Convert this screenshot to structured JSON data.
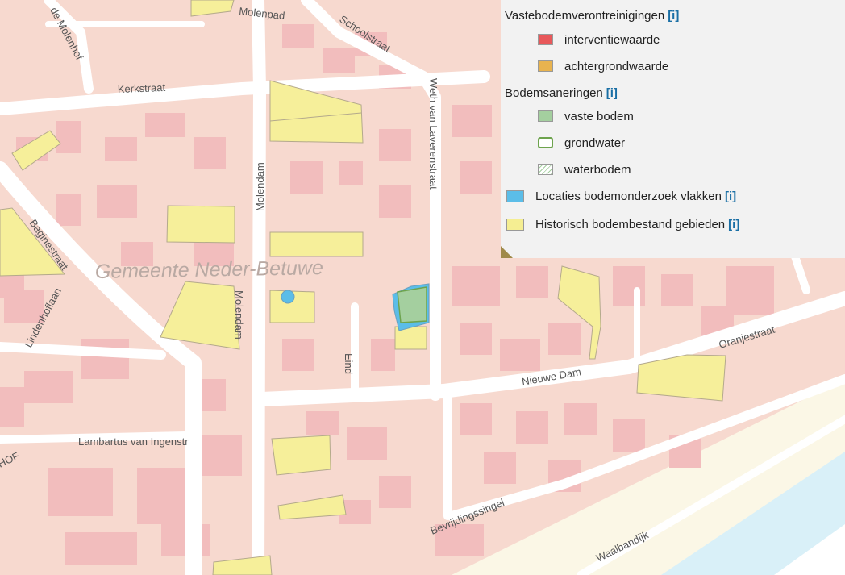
{
  "map": {
    "municipality_label": "Gemeente Neder-Betuwe",
    "streets": {
      "molenhof": "de Molenhof",
      "molenpad": "Molenpad",
      "schoolstraat": "Schoolstraat",
      "kerkstraat": "Kerkstraat",
      "molendam_north": "Molendam",
      "molendam_south": "Molendam",
      "laverenstraat": "Weth van Laverenstraat",
      "baginestraat": "Baginestraat",
      "lindenhoflaan": "Lindenhoflaan",
      "eind": "Eind",
      "nieuwe_dam": "Nieuwe Dam",
      "oranjestraat": "Oranjestraat",
      "lambartus": "Lambartus van Ingenstr",
      "hof": "HOF",
      "bevrijdingssingel": "Bevrijdingssingel",
      "waalbandijk": "Waalbandijk"
    },
    "colors": {
      "base": "#f7d9cf",
      "road": "#ffffff",
      "building": "#f2bdbd",
      "historic": "#f6ef9a",
      "historic_stroke": "#b4a98c",
      "dike_band": "#fbf7e6",
      "river": "#cfe9f5"
    }
  },
  "legend": {
    "section1_title": "Vastebodemverontreinigingen",
    "interventiewaarde": "interventiewaarde",
    "achtergrondwaarde": "achtergrondwaarde",
    "section2_title": "Bodemsaneringen",
    "vaste_bodem": "vaste bodem",
    "grondwater": "grondwater",
    "waterbodem": "waterbodem",
    "locaties": "Locaties bodemonderzoek vlakken",
    "historisch": "Historisch bodembestand gebieden",
    "info_label": "[i]",
    "colors": {
      "interventiewaarde": "#e8585a",
      "achtergrondwaarde": "#e8b34f",
      "vaste_bodem": "#a4cf9f",
      "grondwater_stroke": "#6da34d",
      "locaties": "#5bbde8",
      "historisch": "#f5ee92"
    }
  }
}
